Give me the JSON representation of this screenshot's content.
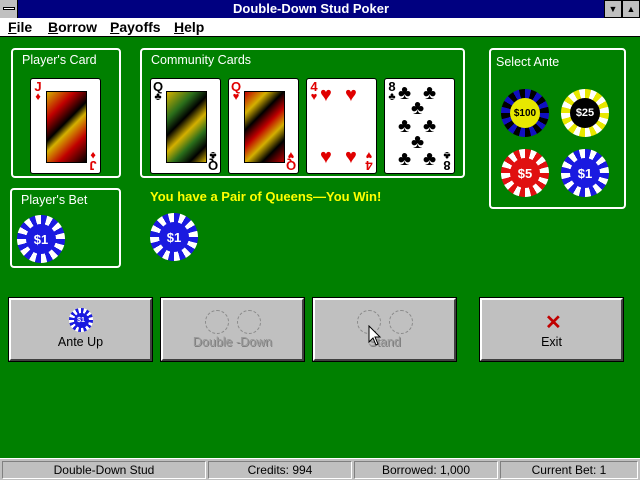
{
  "window": {
    "title": "Double-Down Stud Poker"
  },
  "menu": {
    "items": [
      "File",
      "Borrow",
      "Payoffs",
      "Help"
    ]
  },
  "player_card": {
    "label": "Player's Card",
    "rank": "J",
    "suit": "♦",
    "suit_name": "diamonds"
  },
  "community": {
    "label": "Community Cards",
    "cards": [
      {
        "rank": "Q",
        "suit": "♣",
        "suit_name": "clubs"
      },
      {
        "rank": "Q",
        "suit": "♥",
        "suit_name": "hearts"
      },
      {
        "rank": "4",
        "suit": "♥",
        "suit_name": "hearts"
      },
      {
        "rank": "8",
        "suit": "♣",
        "suit_name": "clubs"
      }
    ]
  },
  "ante": {
    "label": "Select Ante",
    "chips": [
      {
        "value": "$100",
        "color": "#1010c0"
      },
      {
        "value": "$25",
        "color": "#e8e800"
      },
      {
        "value": "$5",
        "color": "#e01010"
      },
      {
        "value": "$1",
        "color": "#1a1ae0"
      }
    ]
  },
  "bet": {
    "label": "Player's Bet",
    "chip": "$1"
  },
  "table_chip": "$1",
  "message": "You have a Pair of Queens—You Win!",
  "buttons": {
    "ante_up": {
      "label": "Ante Up",
      "chip": "$1",
      "enabled": true
    },
    "double_down": {
      "label": "Double -Down",
      "enabled": false
    },
    "stand": {
      "label": "Stand",
      "enabled": false
    },
    "exit": {
      "label": "Exit",
      "enabled": true
    }
  },
  "status": {
    "game": "Double-Down Stud",
    "credits": "Credits:  994",
    "borrowed": "Borrowed:  1,000",
    "current_bet": "Current Bet:  1"
  },
  "colors": {
    "felt": "#008000",
    "titlebar": "#000080",
    "message": "#ffff00",
    "button_face": "#c0c0c0"
  }
}
